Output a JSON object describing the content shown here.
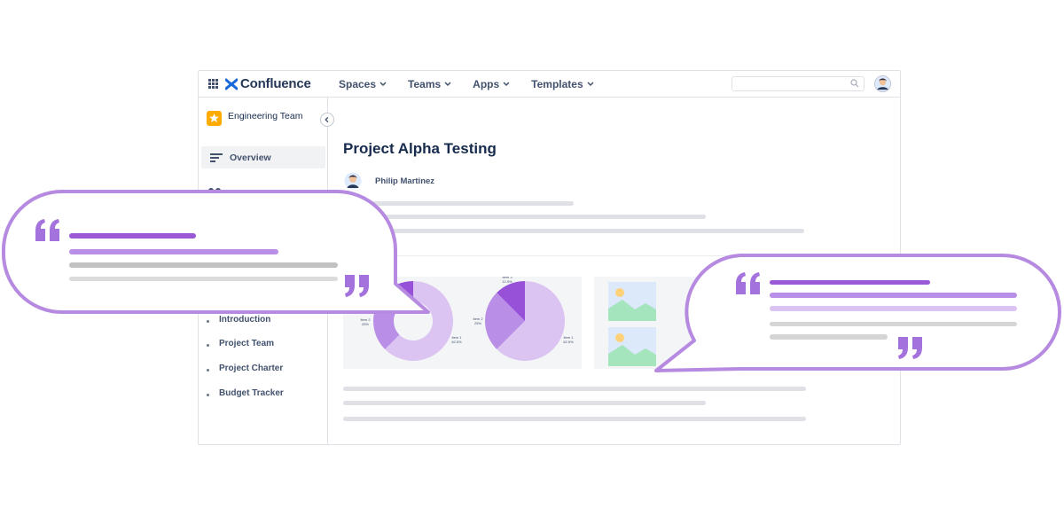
{
  "app": {
    "brand": "Confluence"
  },
  "nav": {
    "items": [
      {
        "label": "Spaces"
      },
      {
        "label": "Teams"
      },
      {
        "label": "Apps"
      },
      {
        "label": "Templates"
      }
    ]
  },
  "search": {
    "placeholder": ""
  },
  "sidebar": {
    "space_name": "Engineering Team",
    "overview_label": "Overview",
    "tree": [
      {
        "label": "Introduction"
      },
      {
        "label": "Project Team"
      },
      {
        "label": "Project Charter"
      },
      {
        "label": "Budget Tracker"
      }
    ]
  },
  "page": {
    "title": "Project Alpha Testing",
    "author": "Philip Martinez"
  },
  "charts": {
    "donut_labels": [
      "Item 2\n25%",
      "Item 1\n62.5%"
    ],
    "pie_labels": [
      "Item 3\n12.5%",
      "Item 2\n25%",
      "Item 1\n62.5%"
    ]
  },
  "chart_data": {
    "type": "pie",
    "categories": [
      "Item 1",
      "Item 2",
      "Item 3"
    ],
    "values": [
      62.5,
      25,
      12.5
    ]
  },
  "colors": {
    "accent_purple": "#9b59d6",
    "bubble_border": "#b58ae0",
    "sidebar_text": "#42526e",
    "space_icon": "#ffab00",
    "slice_1": "#dcc4f2",
    "slice_2": "#b98ee6",
    "slice_3": "#9651d8"
  },
  "icons": {
    "app_switcher": "grid-icon",
    "logo": "confluence-logo-icon",
    "search": "search-icon",
    "collapse": "chevron-left-icon",
    "overview": "overview-lines-icon",
    "quote_open": "quote-open-icon",
    "quote_close": "quote-close-icon"
  }
}
